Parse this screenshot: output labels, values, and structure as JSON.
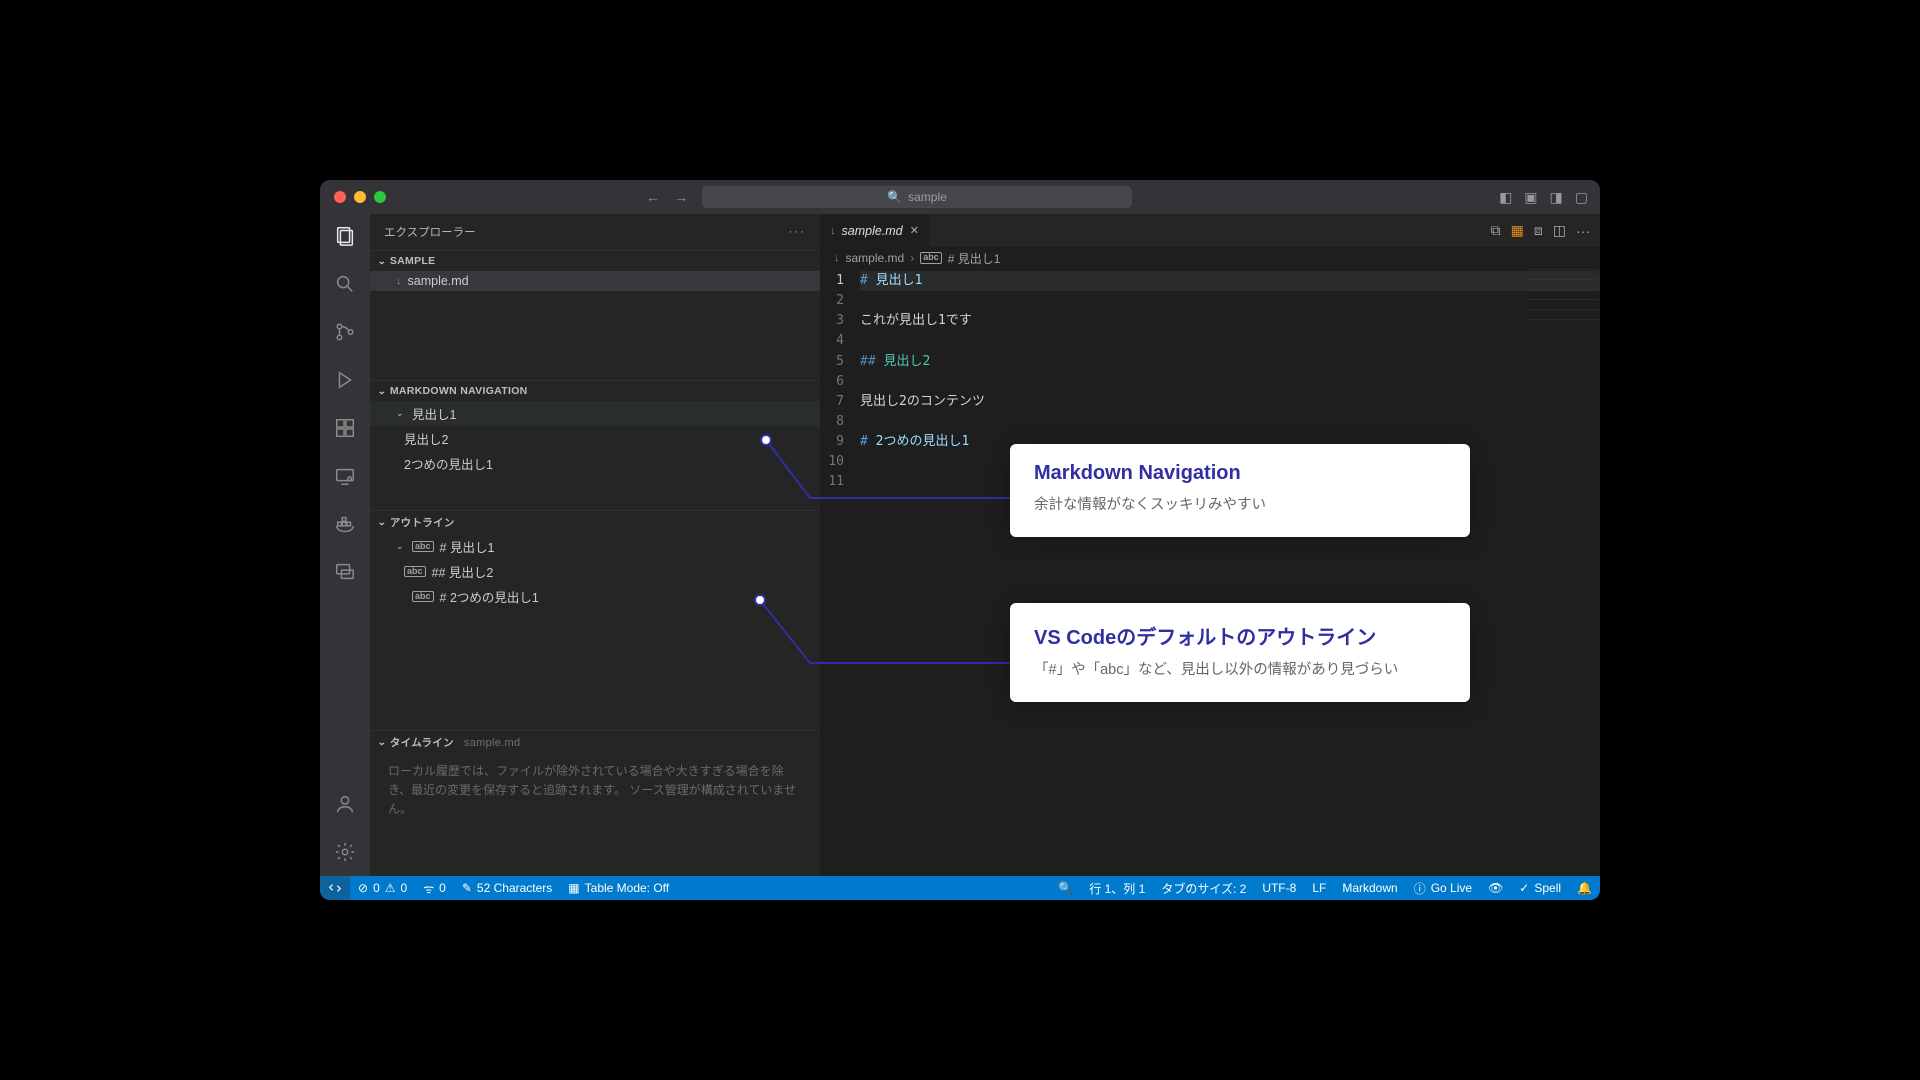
{
  "titlebar": {
    "search_prefix": "",
    "search_text": "sample"
  },
  "sidebar": {
    "explorer_label": "エクスプローラー",
    "sample": {
      "title": "SAMPLE",
      "file": "sample.md"
    },
    "mdnav": {
      "title": "MARKDOWN NAVIGATION",
      "items": [
        "見出し1",
        "見出し2",
        "2つめの見出し1"
      ]
    },
    "outline": {
      "title": "アウトライン",
      "items": [
        "# 見出し1",
        "## 見出し2",
        "# 2つめの見出し1"
      ]
    },
    "timeline": {
      "title": "タイムライン",
      "sub": "sample.md",
      "msg": "ローカル履歴では、ファイルが除外されている場合や大きすぎる場合を除き、最近の変更を保存すると追跡されます。 ソース管理が構成されていません。"
    }
  },
  "editor": {
    "tab_name": "sample.md",
    "breadcrumb_file": "sample.md",
    "breadcrumb_heading": "# 見出し1",
    "lines": {
      "l1_hash": "#",
      "l1_text": "見出し1",
      "l3": "これが見出し1です",
      "l5_hash": "##",
      "l5_text": "見出し2",
      "l7": "見出し2のコンテンツ",
      "l9_hash": "#",
      "l9_text": "2つめの見出し1"
    },
    "gutter": [
      "1",
      "2",
      "3",
      "4",
      "5",
      "6",
      "7",
      "8",
      "9",
      "10",
      "11"
    ]
  },
  "status": {
    "errors": "0",
    "warnings": "0",
    "ports": "0",
    "chars": "52 Characters",
    "table": "Table Mode: Off",
    "cursor": "行 1、列 1",
    "tabsize": "タブのサイズ: 2",
    "enc": "UTF-8",
    "eol": "LF",
    "lang": "Markdown",
    "golive": "Go Live",
    "spell": "Spell"
  },
  "callouts": {
    "c1t": "Markdown Navigation",
    "c1p": "余計な情報がなくスッキリみやすい",
    "c2t": "VS Codeのデフォルトのアウトライン",
    "c2p": "「#」や「abc」など、見出し以外の情報があり見づらい"
  }
}
